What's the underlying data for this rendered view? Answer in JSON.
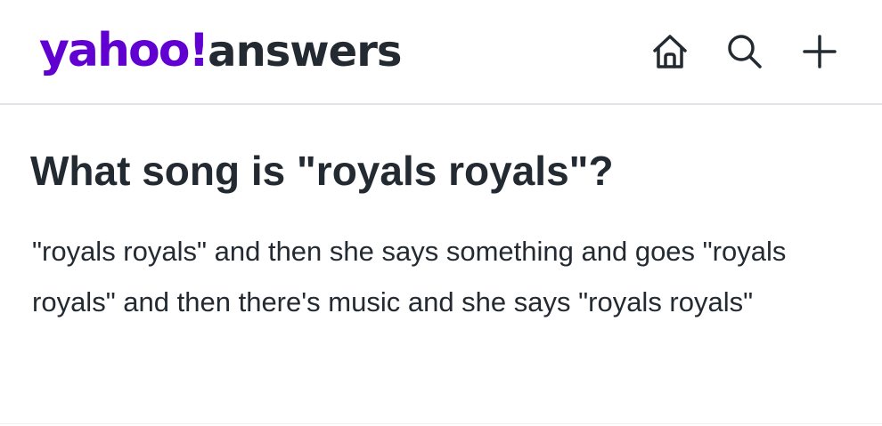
{
  "header": {
    "logo_yahoo": "yahoo!",
    "logo_answers": "answers",
    "icons": [
      "home-icon",
      "search-icon",
      "plus-icon"
    ]
  },
  "question": {
    "title": "What song is \"royals royals\"?",
    "body": "\"royals royals\" and then she says something and goes \"royals royals\" and then there's music and she says \"royals royals\""
  },
  "colors": {
    "brand": "#6001d2",
    "text": "#232a31",
    "divider": "#e0e4e9"
  }
}
